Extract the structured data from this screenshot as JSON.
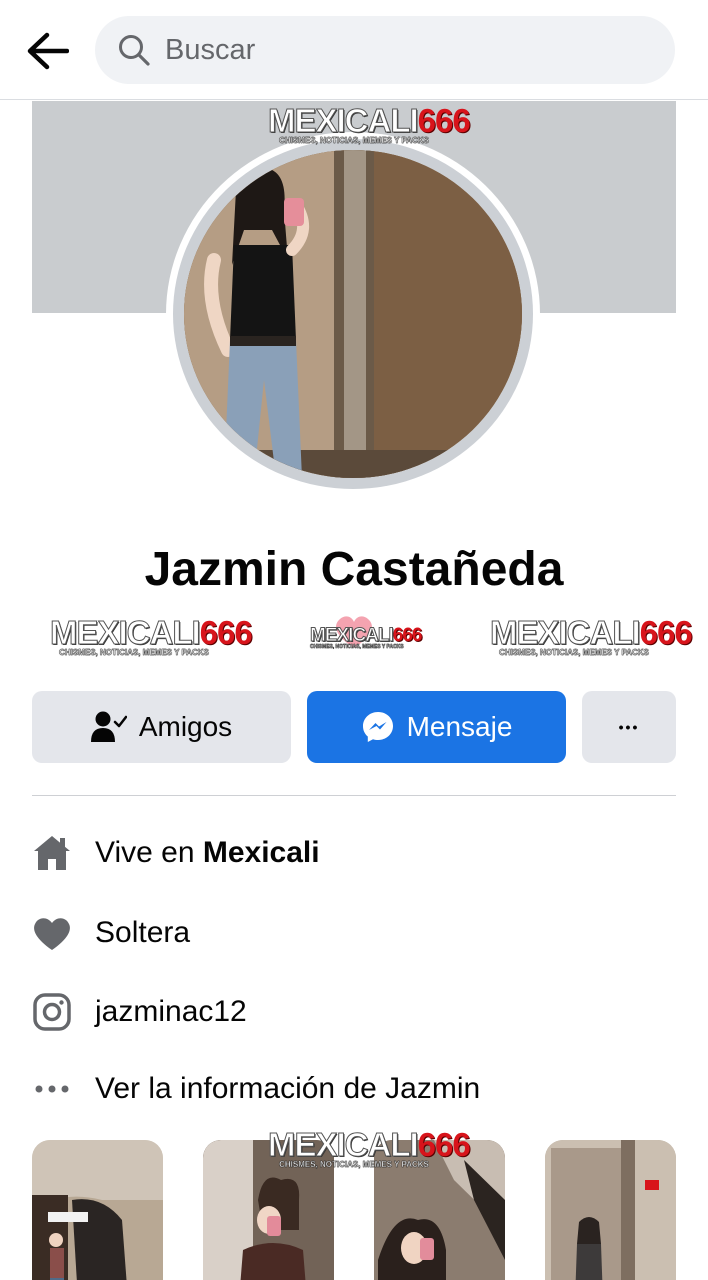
{
  "search": {
    "placeholder": "Buscar"
  },
  "watermark": {
    "main": "MEXICALI",
    "number": "666",
    "tagline": "CHISMES, NOTICIAS, MEMES Y PACKS"
  },
  "profile": {
    "name": "Jazmin Castañeda"
  },
  "actions": {
    "friends_label": "Amigos",
    "message_label": "Mensaje",
    "more_label": "•••"
  },
  "info": {
    "lives_prefix": "Vive en ",
    "lives_city": "Mexicali",
    "relationship": "Soltera",
    "instagram": "jazminac12",
    "see_more": "Ver la información de Jazmin"
  },
  "colors": {
    "accent": "#1b74e4",
    "button_gray": "#e4e6eb",
    "icon_gray": "#65676b",
    "cover": "#c9cccf"
  },
  "icons": [
    "back-arrow-icon",
    "search-icon",
    "friends-check-icon",
    "messenger-icon",
    "more-dots-icon",
    "home-icon",
    "heart-icon",
    "instagram-icon",
    "dots-icon"
  ]
}
